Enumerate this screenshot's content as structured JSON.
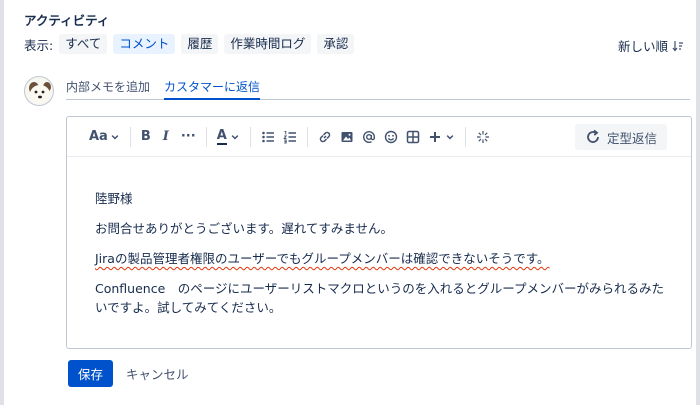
{
  "header": {
    "title": "アクティビティ",
    "filter_label": "表示:",
    "filters": [
      "すべて",
      "コメント",
      "履歴",
      "作業時間ログ",
      "承認"
    ],
    "active_filter": "コメント",
    "sort_label": "新しい順"
  },
  "composer": {
    "tabs": [
      "内部メモを追加",
      "カスタマーに返信"
    ],
    "active_tab": "カスタマーに返信"
  },
  "toolbar": {
    "text_style_label": "Aa",
    "bold_label": "B",
    "italic_label": "I",
    "more_label": "···",
    "color_label": "A",
    "canned_label": "定型返信"
  },
  "editor": {
    "paragraphs": [
      "陸野様",
      "お問合せありがとうございます。遅れてすみません。",
      "Jiraの製品管理者権限のユーザーでもグループメンバーは確認できないそうです。",
      "Confluence　のページにユーザーリストマクロというのを入れるとグループメンバーがみられるみたいですよ。試してみてください。"
    ]
  },
  "actions": {
    "save_label": "保存",
    "cancel_label": "キャンセル"
  },
  "colors": {
    "accent": "#0052cc",
    "chip_bg": "#f4f5f7",
    "chip_active_bg": "#e9f2ff"
  }
}
